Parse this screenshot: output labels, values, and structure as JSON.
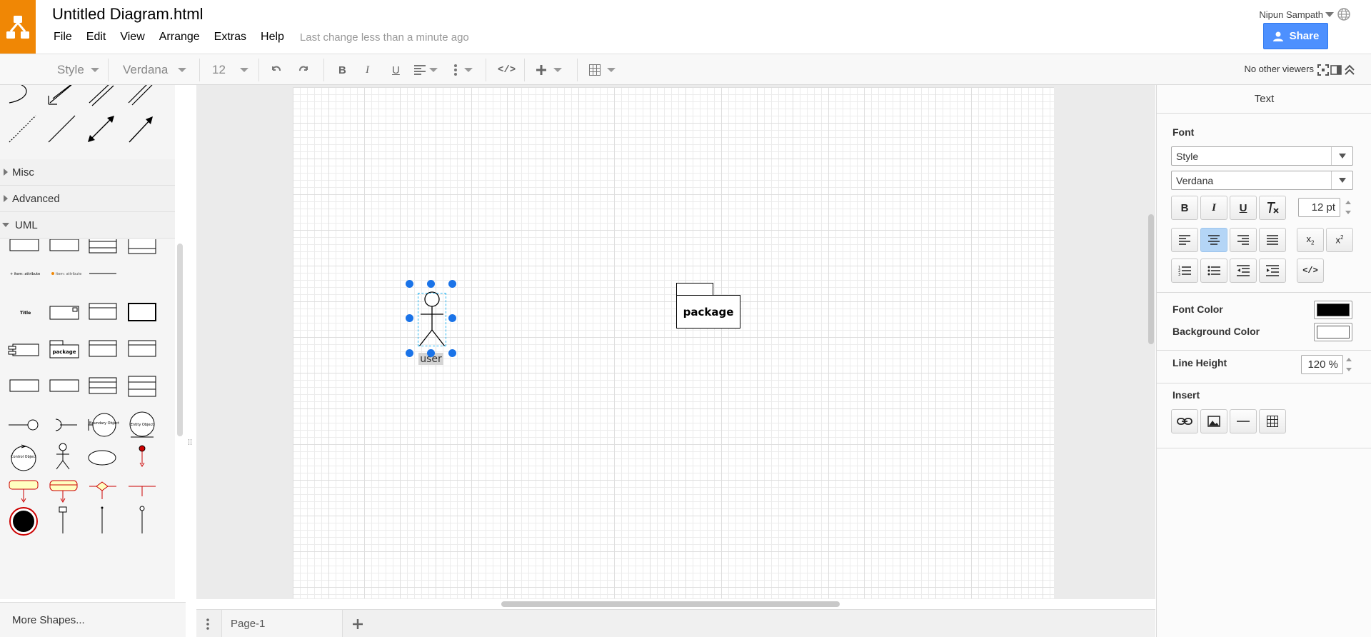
{
  "app": {
    "document_title": "Untitled Diagram.html",
    "menu": [
      "File",
      "Edit",
      "View",
      "Arrange",
      "Extras",
      "Help"
    ],
    "last_change": "Last change less than a minute ago",
    "user_name": "Nipun Sampath",
    "share_label": "Share",
    "brand_color": "#f08705",
    "accent_color": "#4d90fe"
  },
  "toolbar": {
    "style_label": "Style",
    "font_label": "Verdana",
    "font_size": "12",
    "viewers": "No other viewers"
  },
  "sidebar": {
    "sections": [
      {
        "label": "Misc",
        "expanded": false
      },
      {
        "label": "Advanced",
        "expanded": false
      },
      {
        "label": "UML",
        "expanded": true
      }
    ],
    "uml_shape_labels": {
      "package": "package",
      "boundary_object": "Boundary Object",
      "entity_object": "Entity Object",
      "control_object": "Control Object"
    },
    "more_shapes": "More Shapes..."
  },
  "canvas": {
    "actor_label": "user",
    "package_label": "package"
  },
  "pages": {
    "tabs": [
      "Page-1"
    ]
  },
  "format_panel": {
    "title": "Text",
    "font_section": "Font",
    "style_select": "Style",
    "font_select": "Verdana",
    "font_size": "12 pt",
    "font_color_label": "Font Color",
    "font_color": "#000000",
    "background_color_label": "Background Color",
    "background_color": "#ffffff",
    "line_height_label": "Line Height",
    "line_height": "120 %",
    "insert_label": "Insert",
    "active_alignment": "center"
  }
}
